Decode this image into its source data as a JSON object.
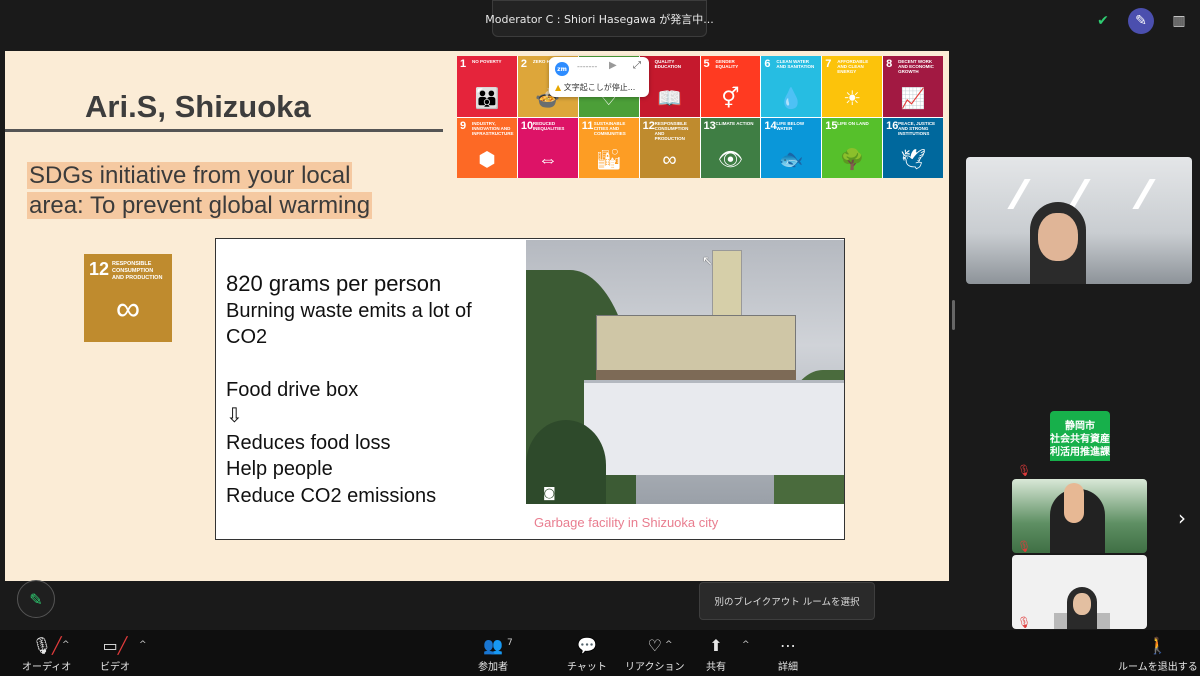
{
  "meeting": {
    "speaker_notice": "Moderator C : Shiori Hasegawa が発言中..."
  },
  "top_icons": [
    "shield-check-icon",
    "annotate-avatar-icon",
    "layout-icon"
  ],
  "slide": {
    "title": "Ari.S, Shizuoka",
    "subtitle_line1": "SDGs initiative from your local",
    "subtitle_line2": "area: To prevent global warming",
    "sdg_goals": [
      {
        "num": "1",
        "label": "NO POVERTY",
        "color": "#e5243b",
        "glyph": "👪"
      },
      {
        "num": "2",
        "label": "ZERO HUNGER",
        "color": "#dda63a",
        "glyph": "🍲"
      },
      {
        "num": "3",
        "label": "GOOD HEALTH",
        "color": "#4c9f38",
        "glyph": "♡"
      },
      {
        "num": "4",
        "label": "QUALITY EDUCATION",
        "color": "#c5192d",
        "glyph": "📖"
      },
      {
        "num": "5",
        "label": "GENDER EQUALITY",
        "color": "#ff3a21",
        "glyph": "⚥"
      },
      {
        "num": "6",
        "label": "CLEAN WATER AND SANITATION",
        "color": "#26bde2",
        "glyph": "💧"
      },
      {
        "num": "7",
        "label": "AFFORDABLE AND CLEAN ENERGY",
        "color": "#fcc30b",
        "glyph": "☀"
      },
      {
        "num": "8",
        "label": "DECENT WORK AND ECONOMIC GROWTH",
        "color": "#a21942",
        "glyph": "📈"
      },
      {
        "num": "9",
        "label": "INDUSTRY, INNOVATION AND INFRASTRUCTURE",
        "color": "#fd6925",
        "glyph": "⬢"
      },
      {
        "num": "10",
        "label": "REDUCED INEQUALITIES",
        "color": "#dd1367",
        "glyph": "⇔"
      },
      {
        "num": "11",
        "label": "SUSTAINABLE CITIES AND COMMUNITIES",
        "color": "#fd9d24",
        "glyph": "🏙"
      },
      {
        "num": "12",
        "label": "RESPONSIBLE CONSUMPTION AND PRODUCTION",
        "color": "#bf8b2e",
        "glyph": "∞"
      },
      {
        "num": "13",
        "label": "CLIMATE ACTION",
        "color": "#3f7e44",
        "glyph": "👁"
      },
      {
        "num": "14",
        "label": "LIFE BELOW WATER",
        "color": "#0a97d9",
        "glyph": "🐟"
      },
      {
        "num": "15",
        "label": "LIFE ON LAND",
        "color": "#56c02b",
        "glyph": "🌳"
      },
      {
        "num": "16",
        "label": "PEACE, JUSTICE AND STRONG INSTITUTIONS",
        "color": "#00689d",
        "glyph": "🕊"
      }
    ],
    "sdg12_badge": {
      "num": "12",
      "label_line1": "RESPONSIBLE",
      "label_line2": "CONSUMPTION",
      "label_line3": "AND PRODUCTION",
      "glyph": "∞"
    },
    "lines": {
      "l1": "820 grams per person",
      "l2": "Burning waste emits a lot of",
      "l3": "CO2",
      "l4": "Food drive box",
      "l5": "⇩",
      "l6": "Reduces food loss",
      "l7": "Help people",
      "l8": "Reduce CO2 emissions"
    },
    "photo_caption": "Garbage facility in Shizuoka city"
  },
  "zoom_popup": {
    "badge": "zm",
    "dots": "-------",
    "status": "文字起こしが停止..."
  },
  "side_panel": {
    "sign_text_line1": "静岡市",
    "sign_text_line2": "社会共有資産",
    "sign_text_line3": "利活用推進課"
  },
  "tooltip": "別のブレイクアウト ルームを選択",
  "toolbar": {
    "audio": "オーディオ",
    "video": "ビデオ",
    "participants": "参加者",
    "participants_count": "7",
    "chat": "チャット",
    "reactions": "リアクション",
    "share": "共有",
    "more": "詳細",
    "leave_room": "ルームを退出する"
  }
}
